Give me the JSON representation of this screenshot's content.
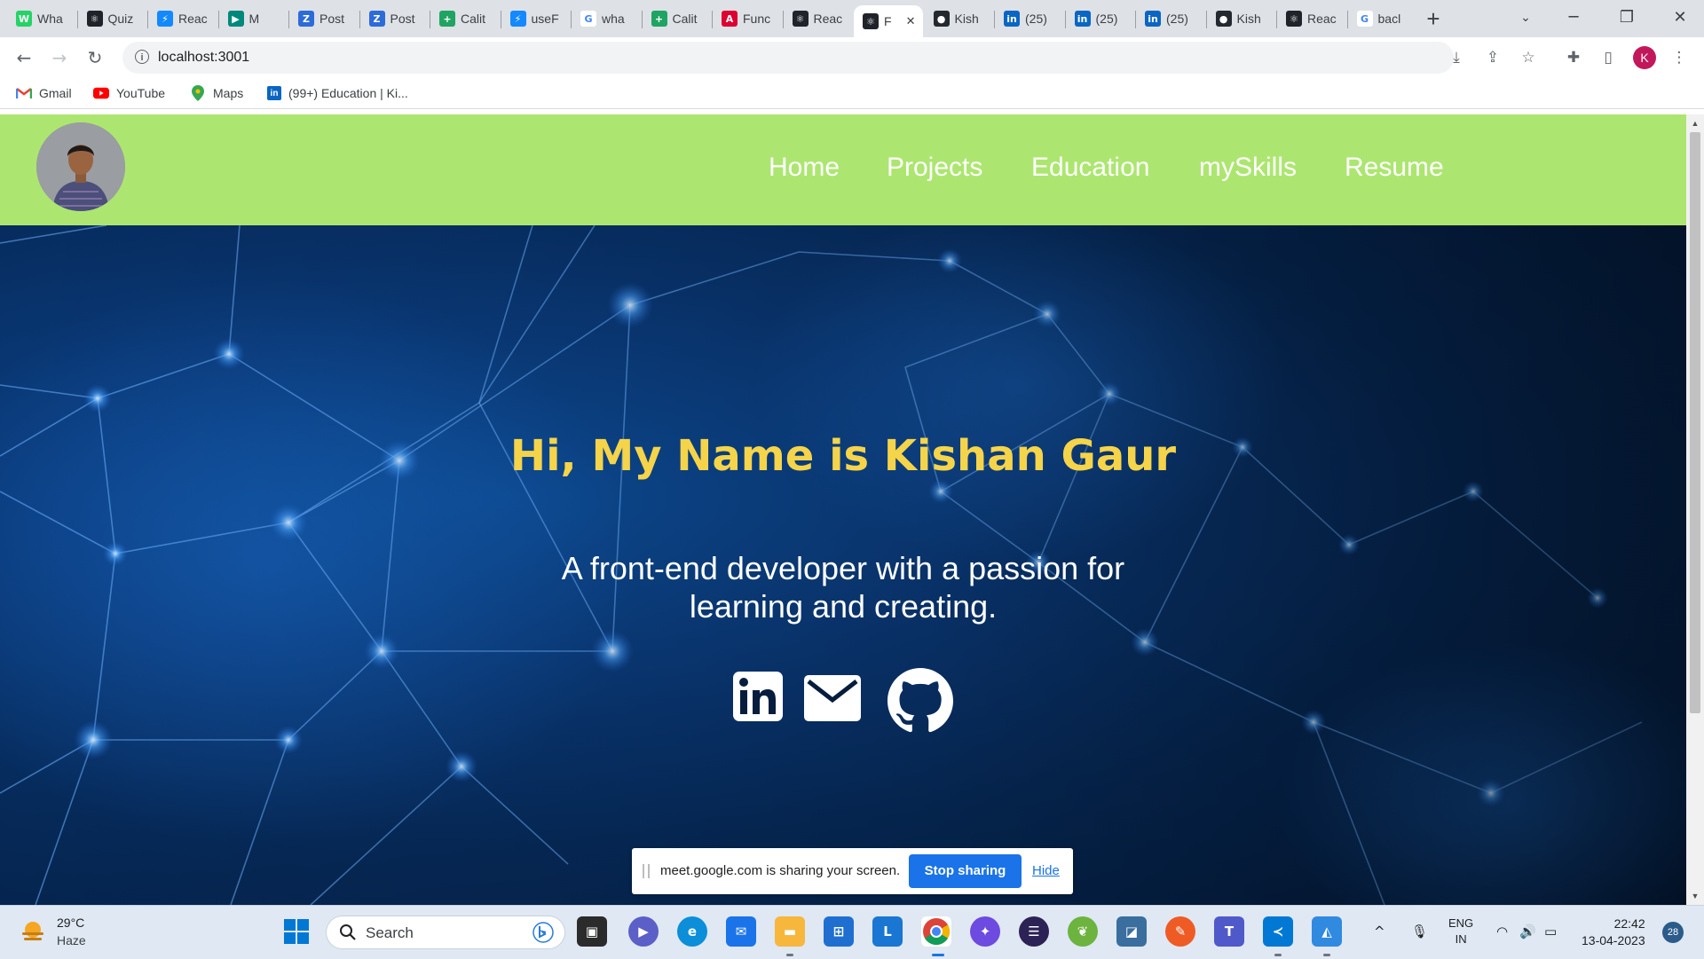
{
  "browser": {
    "tabs": [
      {
        "label": "Wha",
        "icon": "whatsapp-icon",
        "color": "#25d366",
        "glyph": "W"
      },
      {
        "label": "Quiz",
        "icon": "react-icon",
        "color": "#20232a",
        "glyph": "⚛"
      },
      {
        "label": "Reac",
        "icon": "stackblitz-icon",
        "color": "#1389fd",
        "glyph": "⚡"
      },
      {
        "label": "M",
        "icon": "google-meet-icon",
        "color": "#00897b",
        "glyph": "▶"
      },
      {
        "label": "Post",
        "icon": "zoho-icon",
        "color": "#2d6bd8",
        "glyph": "Z"
      },
      {
        "label": "Post",
        "icon": "zoho-icon",
        "color": "#2d6bd8",
        "glyph": "Z"
      },
      {
        "label": "Calit",
        "icon": "sheets-icon",
        "color": "#1fa463",
        "glyph": "+"
      },
      {
        "label": "useF",
        "icon": "stackblitz-icon",
        "color": "#1389fd",
        "glyph": "⚡"
      },
      {
        "label": "wha",
        "icon": "google-icon",
        "color": "#ffffff",
        "glyph": "G"
      },
      {
        "label": "Calit",
        "icon": "sheets-icon",
        "color": "#1fa463",
        "glyph": "+"
      },
      {
        "label": "Func",
        "icon": "angular-icon",
        "color": "#dd0031",
        "glyph": "A"
      },
      {
        "label": "Reac",
        "icon": "react-icon",
        "color": "#20232a",
        "glyph": "⚛"
      },
      {
        "label": "F",
        "icon": "react-icon",
        "color": "#20232a",
        "glyph": "⚛"
      },
      {
        "label": "Kish",
        "icon": "github-icon",
        "color": "#24292f",
        "glyph": "●"
      },
      {
        "label": "(25)",
        "icon": "linkedin-icon",
        "color": "#0a66c2",
        "glyph": "in"
      },
      {
        "label": "(25)",
        "icon": "linkedin-icon",
        "color": "#0a66c2",
        "glyph": "in"
      },
      {
        "label": "(25)",
        "icon": "linkedin-icon",
        "color": "#0a66c2",
        "glyph": "in"
      },
      {
        "label": "Kish",
        "icon": "github-icon",
        "color": "#24292f",
        "glyph": "●"
      },
      {
        "label": "Reac",
        "icon": "react-icon",
        "color": "#20232a",
        "glyph": "⚛"
      },
      {
        "label": "bacl",
        "icon": "google-icon",
        "color": "#ffffff",
        "glyph": "G"
      }
    ],
    "active_tab_index": 12,
    "url": "localhost:3001",
    "profile_initial": "K",
    "bookmarks": [
      {
        "label": "Gmail",
        "icon": "gmail-icon"
      },
      {
        "label": "YouTube",
        "icon": "youtube-icon"
      },
      {
        "label": "Maps",
        "icon": "maps-icon"
      },
      {
        "label": "(99+) Education | Ki...",
        "icon": "linkedin-icon"
      }
    ]
  },
  "page": {
    "nav": {
      "items": [
        "Home",
        "Projects",
        "Education",
        "mySkills",
        "Resume"
      ]
    },
    "hero": {
      "title": "Hi, My Name is Kishan Gaur",
      "subtitle": "A front-end developer with a passion for learning and creating.",
      "social": [
        "linkedin-icon",
        "mail-icon",
        "github-icon"
      ]
    },
    "colors": {
      "navbar": "#ace670",
      "title": "#f5d44a",
      "hero_bg": "#062a5a"
    }
  },
  "share_bar": {
    "text": "meet.google.com is sharing your screen.",
    "stop_label": "Stop sharing",
    "hide_label": "Hide"
  },
  "taskbar": {
    "weather": {
      "temp": "29°C",
      "desc": "Haze"
    },
    "search_label": "Search",
    "lang_line1": "ENG",
    "lang_line2": "IN",
    "time": "22:42",
    "date": "13-04-2023",
    "notifications": "28"
  }
}
